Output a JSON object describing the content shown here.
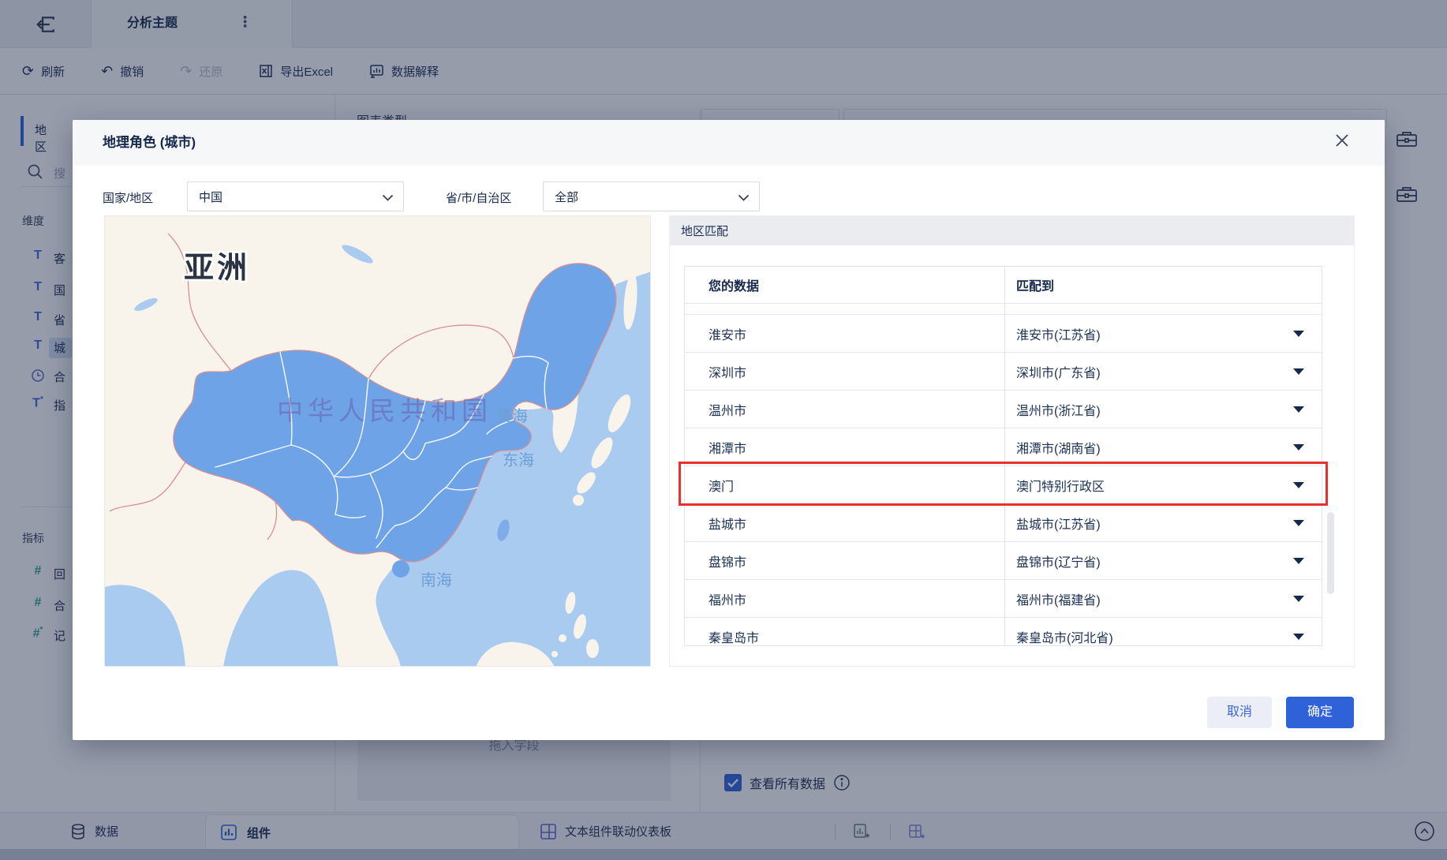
{
  "topbar": {
    "title": "分析主题"
  },
  "toolbar": {
    "items": [
      {
        "icon": "refresh-icon",
        "label": "刷新"
      },
      {
        "icon": "undo-icon",
        "label": "撤销"
      },
      {
        "icon": "redo-icon",
        "label": "还原",
        "disabled": true
      },
      {
        "icon": "export-excel-icon",
        "label": "导出Excel"
      },
      {
        "icon": "data-explain-icon",
        "label": "数据解释"
      }
    ]
  },
  "sidebar": {
    "tab": "地区",
    "search_placeholder": "搜",
    "dimensions_title": "维度",
    "dimension_fields": [
      {
        "icon": "text-field-icon",
        "label": "客"
      },
      {
        "icon": "text-field-icon",
        "label": "国"
      },
      {
        "icon": "text-field-icon",
        "label": "省"
      },
      {
        "icon": "text-field-icon",
        "label": "城",
        "highlighted": true
      },
      {
        "icon": "date-field-icon",
        "label": "合"
      },
      {
        "icon": "calc-text-field-icon",
        "label": "指"
      }
    ],
    "metrics_title": "指标",
    "metric_fields": [
      {
        "icon": "number-field-icon",
        "label": "回"
      },
      {
        "icon": "number-field-icon",
        "label": "合"
      },
      {
        "icon": "calc-number-field-icon",
        "label": "记"
      }
    ]
  },
  "canvas": {
    "chart_type_label": "图表类型",
    "drop_hint": "拖入字段",
    "view_all_label": "查看所有数据",
    "view_all_checked": true
  },
  "bottombar": {
    "data_label": "数据",
    "component_tab_label": "组件",
    "dashboard_label": "文本组件联动仪表板"
  },
  "modal": {
    "title": "地理角色 (城市)",
    "country_label": "国家/地区",
    "country_value": "中国",
    "province_label": "省/市/自治区",
    "province_value": "全部",
    "match_section_title": "地区匹配",
    "table": {
      "col_source": "您的数据",
      "col_matched": "匹配到",
      "rows": [
        {
          "source": "淮安市",
          "matched": "淮安市(江苏省)"
        },
        {
          "source": "深圳市",
          "matched": "深圳市(广东省)"
        },
        {
          "source": "温州市",
          "matched": "温州市(浙江省)"
        },
        {
          "source": "湘潭市",
          "matched": "湘潭市(湖南省)"
        },
        {
          "source": "澳门",
          "matched": "澳门特别行政区",
          "highlighted": true
        },
        {
          "source": "盐城市",
          "matched": "盐城市(江苏省)"
        },
        {
          "source": "盘锦市",
          "matched": "盘锦市(辽宁省)"
        },
        {
          "source": "福州市",
          "matched": "福州市(福建省)"
        },
        {
          "source": "秦皇岛市",
          "matched": "秦皇岛市(河北省)"
        }
      ]
    },
    "cancel_label": "取消",
    "confirm_label": "确定"
  },
  "map": {
    "continent_label": "亚洲",
    "country_watermark": "中华人民共和国",
    "sea_labels": [
      "黄海",
      "东海",
      "南海"
    ]
  },
  "colors": {
    "primary": "#2F62D9",
    "highlight_red": "#E8302E",
    "teal": "#2AA198",
    "china_fill": "#6FA3E7",
    "ocean": "#A9CBF0",
    "land": "#F8F4EC"
  }
}
